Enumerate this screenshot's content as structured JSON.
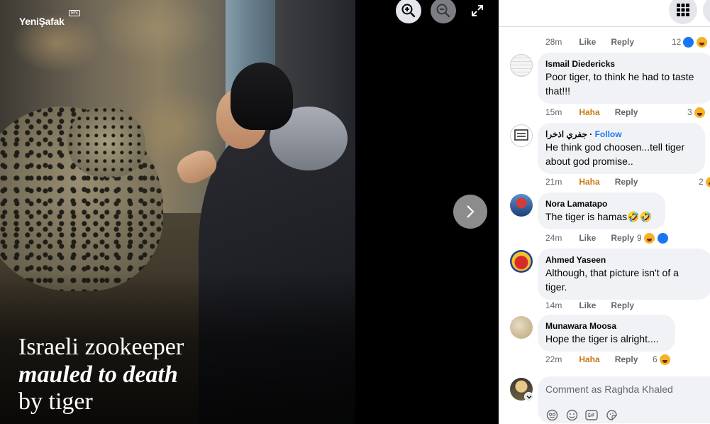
{
  "photo": {
    "brand": "YeniŞafak",
    "brand_sup": "EN",
    "headline": {
      "line1": "Israeli zookeeper",
      "line2": "mauled to death",
      "line3": "by tiger"
    }
  },
  "comments": [
    {
      "partial": true,
      "time": "28m",
      "action": "Like",
      "reply": "Reply",
      "reaction_count": "12",
      "reactions": [
        "like",
        "haha"
      ]
    },
    {
      "name": "Ismail Diedericks",
      "text": "Poor tiger, to think he had to taste that!!!",
      "time": "15m",
      "action": "Haha",
      "reply": "Reply",
      "reaction_count": "3",
      "reactions": [
        "haha"
      ]
    },
    {
      "name": "جفري اذخرا",
      "follow": "Follow",
      "text": "He think god choosen...tell tiger about god promise..",
      "time": "21m",
      "action": "Haha",
      "reply": "Reply",
      "reaction_count": "2",
      "reactions": [
        "haha"
      ]
    },
    {
      "name": "Nora Lamatapo",
      "text": "The tiger is hamas🤣🤣",
      "time": "24m",
      "action": "Like",
      "reply": "Reply",
      "reaction_count": "9",
      "reactions": [
        "haha",
        "like"
      ]
    },
    {
      "name": "Ahmed Yaseen",
      "text": "Although, that picture isn't of a tiger.",
      "time": "14m",
      "action": "Like",
      "reply": "Reply"
    },
    {
      "name": "Munawara Moosa",
      "text": "Hope the tiger is alright....",
      "time": "22m",
      "action": "Haha",
      "reply": "Reply",
      "reaction_count": "6",
      "reactions": [
        "haha"
      ]
    }
  ],
  "composer": {
    "placeholder": "Comment as Raghda Khaled"
  },
  "colors": {
    "accent": "#1877f2",
    "haha": "#c97a18",
    "bubble": "#f0f2f5",
    "meta": "#65676b"
  }
}
